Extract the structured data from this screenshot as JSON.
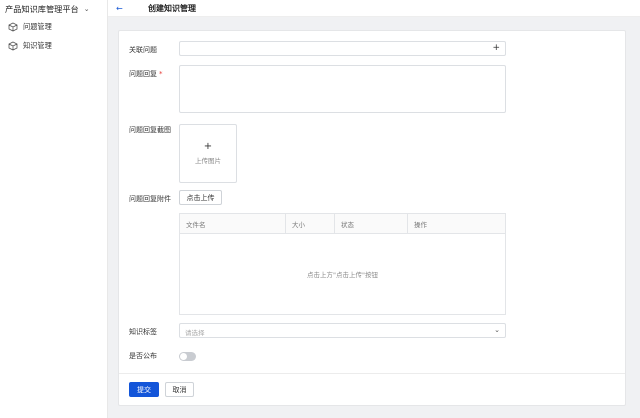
{
  "app": {
    "title": "产品知识库管理平台"
  },
  "sidebar": {
    "items": [
      {
        "label": "问题管理",
        "icon": "cube-icon"
      },
      {
        "label": "知识管理",
        "icon": "cube-icon"
      }
    ]
  },
  "header": {
    "title": "创建知识管理"
  },
  "form": {
    "related_question_label": "关联问题",
    "answer_label": "问题回复",
    "answer_required_mark": "*",
    "screenshot_label": "问题回复截图",
    "upload_image_plus": "+",
    "upload_image_text": "上传图片",
    "attachment_label": "问题回复附件",
    "upload_button": "点击上传",
    "table": {
      "columns": [
        "文件名",
        "大小",
        "状态",
        "操作"
      ],
      "empty_text": "点击上方\"点击上传\"按钮"
    },
    "tags_label": "知识标签",
    "tags_placeholder": "请选择",
    "publish_label": "是否公布",
    "publish_value": false,
    "submit_label": "提交",
    "cancel_label": "取消"
  },
  "colors": {
    "primary": "#1355d9",
    "required": "#e53935"
  }
}
